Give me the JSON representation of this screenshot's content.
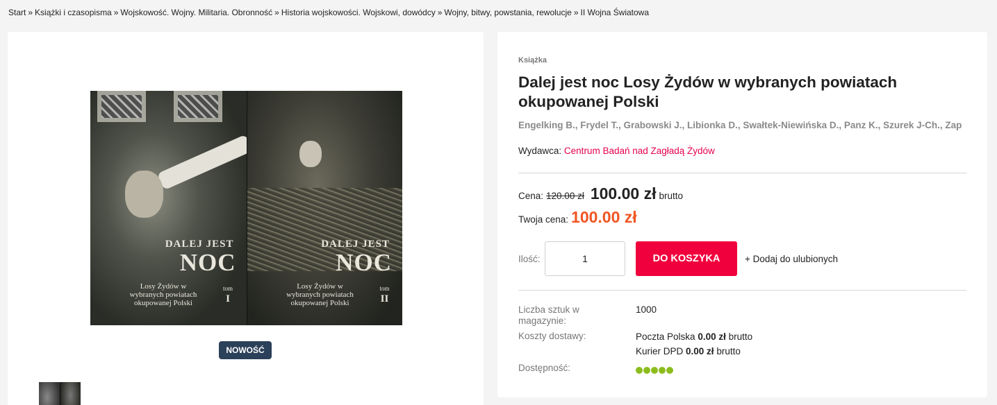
{
  "breadcrumb": {
    "items": [
      "Start",
      "Książki i czasopisma",
      "Wojskowość. Wojny. Militaria. Obronność",
      "Historia wojskowości. Wojskowi, dowódcy",
      "Wojny, bitwy, powstania, rewolucje",
      "II Wojna Światowa"
    ],
    "separator": "»"
  },
  "gallery": {
    "cover": {
      "volume1": {
        "title_top": "DALEJ JEST",
        "title_main": "NOC",
        "subtitle": "Losy Żydów w wybranych powiatach okupowanej Polski",
        "tom_label": "tom",
        "tom_number": "I"
      },
      "volume2": {
        "title_top": "DALEJ JEST",
        "title_main": "NOC",
        "subtitle": "Losy Żydów w wybranych powiatach okupowanej Polski",
        "tom_label": "tom",
        "tom_number": "II"
      }
    },
    "badge": "NOWOŚĆ"
  },
  "product": {
    "category": "Książka",
    "title": "Dalej jest noc Losy Żydów w wybranych powiatach okupowanej Polski",
    "authors": "Engelking B., Frydel T., Grabowski J., Libionka D., Swałtek-Niewińska D., Panz K., Szurek J-Ch., Zap",
    "publisher_label": "Wydawca:",
    "publisher_name": "Centrum Badań nad Zagładą Żydów"
  },
  "pricing": {
    "price_label": "Cena:",
    "old_price": "120.00 zł",
    "price": "100.00 zł",
    "brutto": "brutto",
    "your_price_label": "Twoja cena:",
    "your_price": "100.00 zł"
  },
  "purchase": {
    "qty_label": "Ilość:",
    "qty_value": "1",
    "cart_button": "DO KOSZYKA",
    "favorite_link": "+ Dodaj do ulubionych"
  },
  "details": {
    "stock_label": "Liczba sztuk w magazynie:",
    "stock_value": "1000",
    "shipping_label": "Koszty dostawy:",
    "shipping": [
      {
        "carrier": "Poczta Polska",
        "price": "0.00 zł",
        "suffix": "brutto"
      },
      {
        "carrier": "Kurier DPD",
        "price": "0.00 zł",
        "suffix": "brutto"
      }
    ],
    "availability_label": "Dostępność:",
    "availability_level": 5,
    "availability_max": 5,
    "availability_color": "#8cbd1e"
  },
  "colors": {
    "accent_red": "#f0003c",
    "publisher_link": "#e4004f",
    "your_price": "#f05523",
    "badge_bg": "#2b4059"
  }
}
